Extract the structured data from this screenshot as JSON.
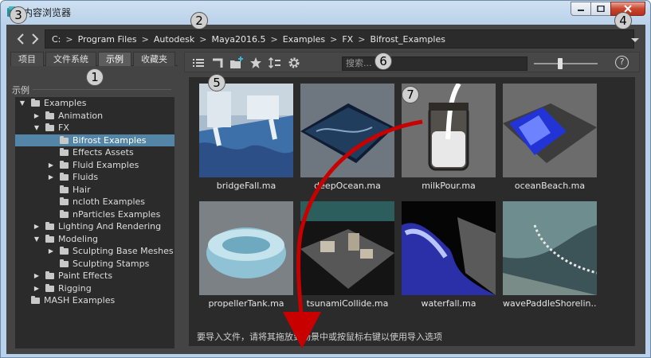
{
  "window": {
    "title": "内容浏览器",
    "controls": [
      "minimize-icon",
      "maximize-icon",
      "close-icon"
    ]
  },
  "path": {
    "crumbs": [
      "C:",
      "Program Files",
      "Autodesk",
      "Maya2016.5",
      "Examples",
      "FX",
      "Bifrost_Examples"
    ],
    "separator": ">"
  },
  "tabs": [
    {
      "label": "项目",
      "active": false
    },
    {
      "label": "文件系统",
      "active": false
    },
    {
      "label": "示例",
      "active": true
    },
    {
      "label": "收藏夹",
      "active": false
    }
  ],
  "section_label": "示例",
  "tree": [
    {
      "label": "Examples",
      "depth": 0,
      "arrow": "expanded",
      "selected": false
    },
    {
      "label": "Animation",
      "depth": 1,
      "arrow": "collapsed",
      "selected": false
    },
    {
      "label": "FX",
      "depth": 1,
      "arrow": "expanded",
      "selected": false
    },
    {
      "label": "Bifrost Examples",
      "depth": 2,
      "arrow": "none",
      "selected": true
    },
    {
      "label": "Effects Assets",
      "depth": 2,
      "arrow": "none",
      "selected": false
    },
    {
      "label": "Fluid Examples",
      "depth": 2,
      "arrow": "collapsed",
      "selected": false
    },
    {
      "label": "Fluids",
      "depth": 2,
      "arrow": "collapsed",
      "selected": false
    },
    {
      "label": "Hair",
      "depth": 2,
      "arrow": "none",
      "selected": false
    },
    {
      "label": "ncloth Examples",
      "depth": 2,
      "arrow": "none",
      "selected": false
    },
    {
      "label": "nParticles Examples",
      "depth": 2,
      "arrow": "none",
      "selected": false
    },
    {
      "label": "Lighting And Rendering",
      "depth": 1,
      "arrow": "collapsed",
      "selected": false
    },
    {
      "label": "Modeling",
      "depth": 1,
      "arrow": "expanded",
      "selected": false
    },
    {
      "label": "Sculpting Base Meshes",
      "depth": 2,
      "arrow": "collapsed",
      "selected": false
    },
    {
      "label": "Sculpting Stamps",
      "depth": 2,
      "arrow": "none",
      "selected": false
    },
    {
      "label": "Paint Effects",
      "depth": 1,
      "arrow": "collapsed",
      "selected": false
    },
    {
      "label": "Rigging",
      "depth": 1,
      "arrow": "collapsed",
      "selected": false
    },
    {
      "label": "MASH Examples",
      "depth": 0,
      "arrow": "none",
      "selected": false
    }
  ],
  "toolbar": {
    "icons": [
      "list-view-icon",
      "go-to-parent-icon",
      "add-folder-icon",
      "favorite-star-icon",
      "sort-icon",
      "settings-gear-icon"
    ],
    "search_placeholder": "搜索...",
    "help_label": "?",
    "zoom_level_fraction": 0.4
  },
  "files": [
    {
      "name": "bridgeFall.ma",
      "thumb": "bridge"
    },
    {
      "name": "deepOcean.ma",
      "thumb": "ocean"
    },
    {
      "name": "milkPour.ma",
      "thumb": "milk"
    },
    {
      "name": "oceanBeach.ma",
      "thumb": "beach"
    },
    {
      "name": "propellerTank.ma",
      "thumb": "tank"
    },
    {
      "name": "tsunamiCollide.ma",
      "thumb": "tsunami"
    },
    {
      "name": "waterfall.ma",
      "thumb": "waterfall"
    },
    {
      "name": "wavePaddleShorelin...",
      "thumb": "shore"
    }
  ],
  "hint_text": "要导入文件，请将其拖放到场景中或按鼠标右键以使用导入选项",
  "callouts": [
    "1",
    "2",
    "3",
    "4",
    "5",
    "6",
    "7"
  ],
  "colors": {
    "panel": "#444444",
    "field": "#2b2b2b",
    "selection": "#5285a6",
    "annotation_arrow": "#c80000"
  }
}
